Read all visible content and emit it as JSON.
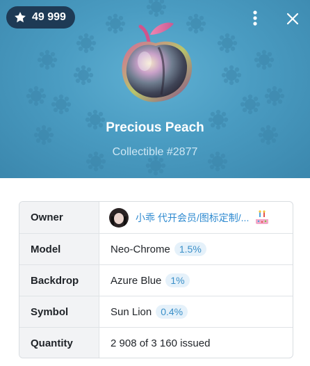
{
  "header": {
    "stars_count": "49 999",
    "icons": {
      "star": "star-icon",
      "menu": "more-vertical-icon",
      "close": "close-icon"
    }
  },
  "gift": {
    "title": "Precious Peach",
    "subtitle": "Collectible #2877",
    "image": "peach-illustration"
  },
  "details": {
    "owner_label": "Owner",
    "owner_name": "小乖 代开会员/图标定制/...",
    "model_label": "Model",
    "model_value": "Neo-Chrome",
    "model_rarity": "1.5%",
    "backdrop_label": "Backdrop",
    "backdrop_value": "Azure Blue",
    "backdrop_rarity": "1%",
    "symbol_label": "Symbol",
    "symbol_value": "Sun Lion",
    "symbol_rarity": "0.4%",
    "quantity_label": "Quantity",
    "quantity_value": "2 908 of 3 160 issued"
  },
  "colors": {
    "backdrop": "#4a9cc2",
    "pill": "#1e3a55",
    "link": "#2e8ad0",
    "badge_bg": "#e5f1fa"
  }
}
